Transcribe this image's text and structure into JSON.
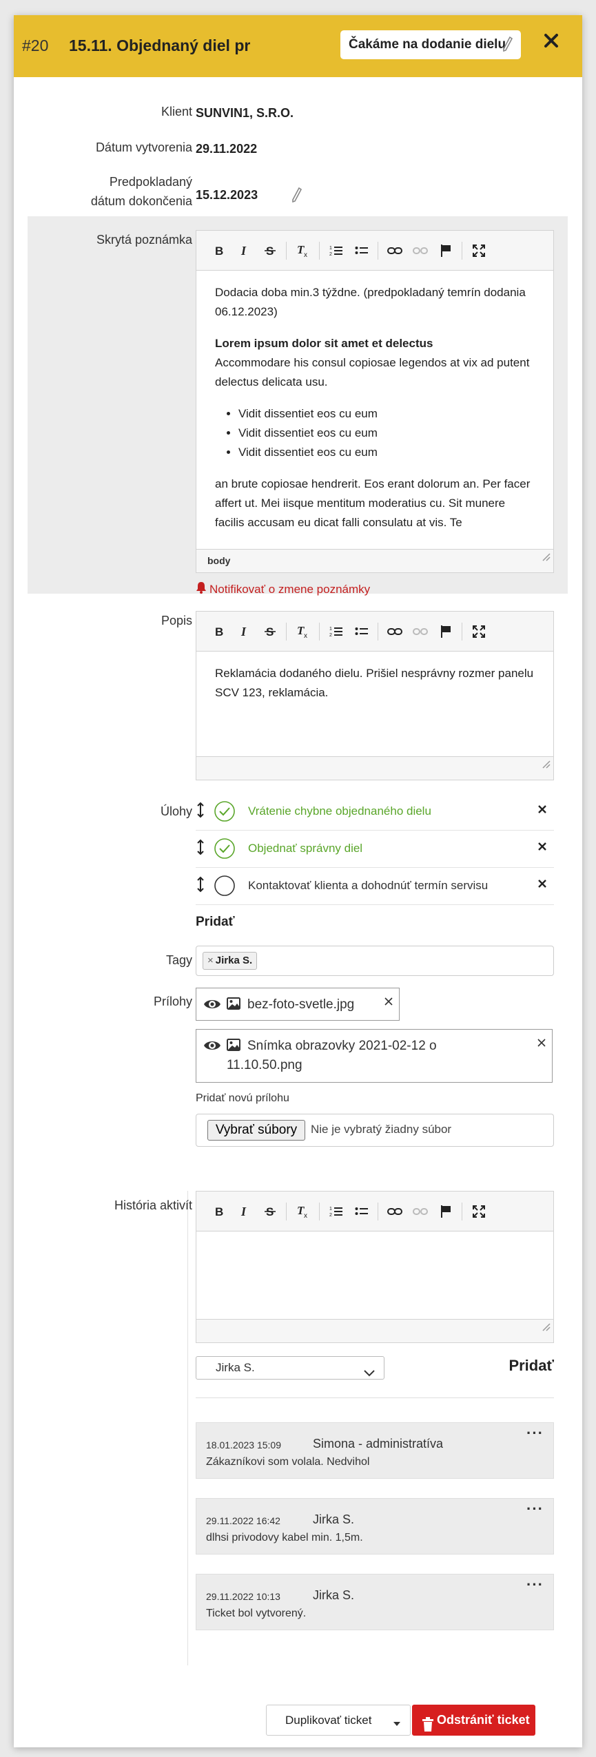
{
  "header": {
    "ticket_id": "#20",
    "title": "15.11. Objednaný diel pr",
    "status": "Čakáme na dodanie dielu"
  },
  "fields": {
    "client_label": "Klient",
    "client_value": "SUNVIN1, S.R.O.",
    "created_label": "Dátum vytvorenia",
    "created_value": "29.11.2022",
    "due_label_line1": "Predpokladaný",
    "due_label_line2": "dátum dokončenia",
    "due_value": "15.12.2023"
  },
  "hidden_note": {
    "label": "Skrytá poznámka",
    "paragraph1": "Dodacia doba min.3 týždne. (predpokladaný temrín dodania 06.12.2023)",
    "heading": "Lorem ipsum dolor sit amet et delectus",
    "paragraph2": "Accommodare his consul copiosae legendos at vix ad putent delectus delicata usu.",
    "bullets": [
      "Vidit dissentiet eos cu eum",
      "Vidit dissentiet eos cu eum",
      "Vidit dissentiet eos cu eum"
    ],
    "paragraph3": "an brute copiosae hendrerit. Eos erant dolorum an. Per facer affert ut. Mei iisque mentitum moderatius cu. Sit munere facilis accusam eu dicat falli consulatu at vis. Te",
    "status_path": "body",
    "notify_label": "Notifikovať o zmene poznámky"
  },
  "description": {
    "label": "Popis",
    "text": "Reklamácia dodaného dielu. Prišiel nesprávny rozmer panelu SCV 123, reklamácia."
  },
  "tasks": {
    "label": "Úlohy",
    "items": [
      {
        "name": "Vrátenie chybne objednaného dielu",
        "done": true
      },
      {
        "name": "Objednať správny diel",
        "done": true
      },
      {
        "name": "Kontaktovať klienta a dohodnúť termín servisu",
        "done": false
      }
    ],
    "add_label": "Pridať"
  },
  "tags": {
    "label": "Tagy",
    "items": [
      "Jirka S."
    ]
  },
  "attachments": {
    "label": "Prílohy",
    "files": [
      "bez-foto-svetle.jpg",
      "Snímka obrazovky 2021-02-12 o",
      "11.10.50.png"
    ],
    "new_label": "Pridať novú prílohu",
    "choose_button": "Vybrať súbory",
    "no_file": "Nie je vybratý žiadny súbor"
  },
  "history": {
    "label": "História aktivít",
    "selected_user": "Jirka S.",
    "add_label": "Pridať",
    "entries": [
      {
        "date": "18.01.2023 15:09",
        "user": "Simona - administratíva",
        "text": "Zákazníkovi som volala. Nedvihol"
      },
      {
        "date": "29.11.2022 16:42",
        "user": "Jirka S.",
        "text": "dlhsi privodovy kabel min. 1,5m."
      },
      {
        "date": "29.11.2022 10:13",
        "user": "Jirka S.",
        "text": "Ticket bol vytvorený."
      }
    ]
  },
  "footer": {
    "duplicate_label": "Duplikovať ticket",
    "delete_label": "Odstrániť ticket"
  },
  "colors": {
    "header": "#e7bd2e",
    "done_green": "#5aa62a",
    "danger_red": "#d71f1f"
  }
}
